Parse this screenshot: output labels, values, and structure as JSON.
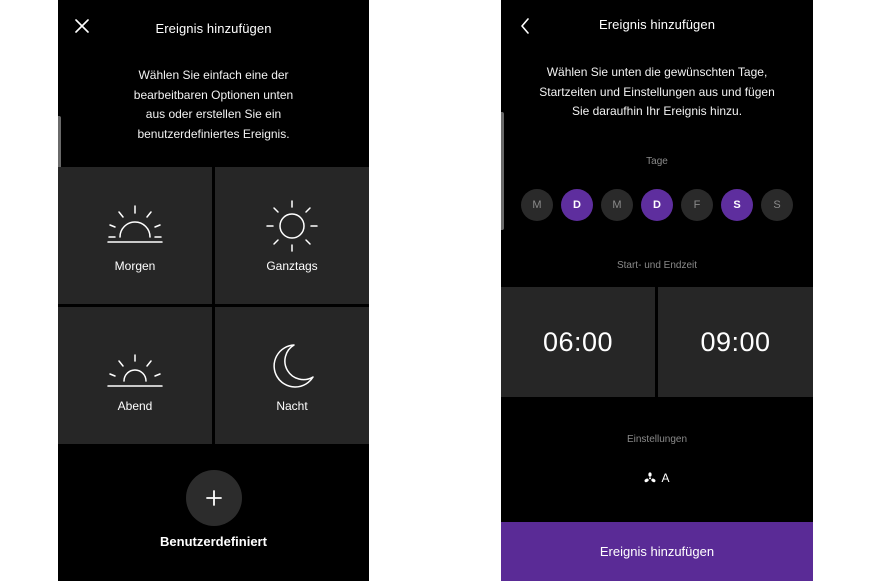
{
  "left_screen": {
    "title": "Ereignis hinzufügen",
    "close_icon": "close-icon",
    "description": [
      "Wählen Sie einfach eine der",
      "bearbeitbaren Optionen unten",
      "aus oder erstellen Sie ein",
      "benutzerdefiniertes Ereignis."
    ],
    "tiles": [
      {
        "label": "Morgen",
        "icon": "sunrise-icon"
      },
      {
        "label": "Ganztags",
        "icon": "sun-icon"
      },
      {
        "label": "Abend",
        "icon": "sunset-icon"
      },
      {
        "label": "Nacht",
        "icon": "moon-icon"
      }
    ],
    "custom_icon": "plus-icon",
    "custom_label": "Benutzerdefiniert"
  },
  "right_screen": {
    "title": "Ereignis hinzufügen",
    "back_icon": "chevron-left-icon",
    "description": [
      "Wählen Sie unten die gewünschten Tage,",
      "Startzeiten und Einstellungen aus und fügen",
      "Sie daraufhin Ihr Ereignis hinzu."
    ],
    "days_label": "Tage",
    "days": [
      {
        "letter": "M",
        "selected": false
      },
      {
        "letter": "D",
        "selected": true
      },
      {
        "letter": "M",
        "selected": false
      },
      {
        "letter": "D",
        "selected": true
      },
      {
        "letter": "F",
        "selected": false
      },
      {
        "letter": "S",
        "selected": true
      },
      {
        "letter": "S",
        "selected": false
      }
    ],
    "time_label": "Start- und Endzeit",
    "start_time": "06:00",
    "end_time": "09:00",
    "settings_label": "Einstellungen",
    "settings_icon": "fan-icon",
    "settings_value": "A",
    "submit_label": "Ereignis hinzufügen"
  },
  "colors": {
    "background": "#000000",
    "tile": "#262626",
    "accent_purple": "#5a2b96",
    "day_selected": "#5e2e9e"
  }
}
